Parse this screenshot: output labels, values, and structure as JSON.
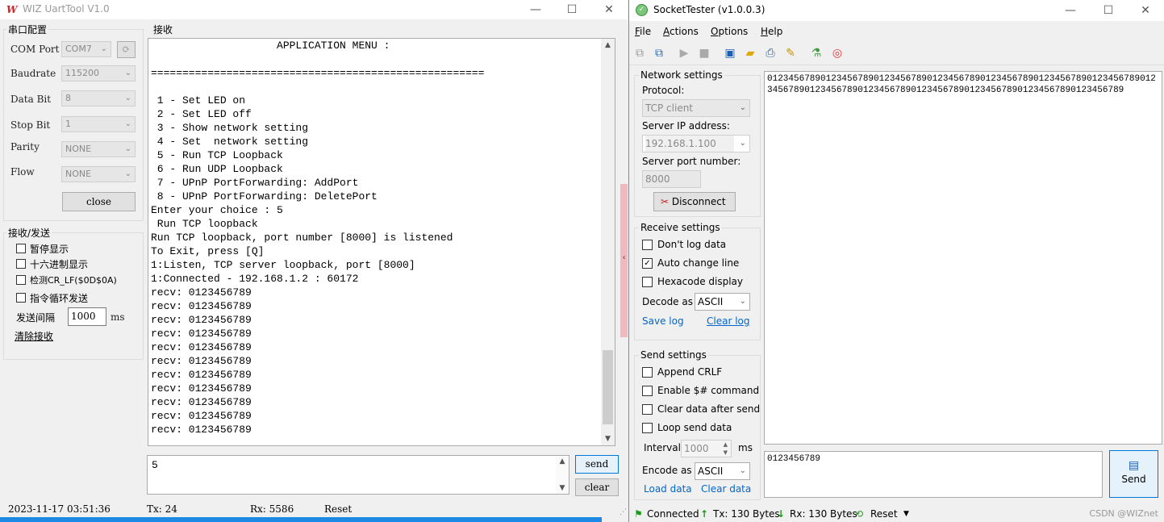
{
  "wiz": {
    "title": "WIZ UartTool V1.0",
    "logo": "W",
    "controls": {
      "minimize": "—",
      "maximize": "☐",
      "close": "✕"
    },
    "serial_config": {
      "title": "串口配置",
      "com_label": "COM Port",
      "com_value": "COM7",
      "baud_label": "Baudrate",
      "baud_value": "115200",
      "databit_label": "Data Bit",
      "databit_value": "8",
      "stopbit_label": "Stop Bit",
      "stopbit_value": "1",
      "parity_label": "Parity",
      "parity_value": "NONE",
      "flow_label": "Flow",
      "flow_value": "NONE",
      "close_button": "close"
    },
    "rxtx": {
      "title": "接收/发送",
      "pause_display": "暂停显示",
      "hex_display": "十六进制显示",
      "detect_crlf": "检测CR_LF($0D$0A)",
      "loop_send": "指令循环发送",
      "interval_label": "发送间隔",
      "interval_value": "1000",
      "interval_unit": "ms",
      "clear_receive": "清除接收"
    },
    "receive_title": "接收",
    "terminal_lines": [
      "                    APPLICATION MENU :",
      "",
      "=====================================================",
      "",
      " 1 - Set LED on",
      " 2 - Set LED off",
      " 3 - Show network setting",
      " 4 - Set  network setting",
      " 5 - Run TCP Loopback",
      " 6 - Run UDP Loopback",
      " 7 - UPnP PortForwarding: AddPort",
      " 8 - UPnP PortForwarding: DeletePort",
      "Enter your choice : 5",
      " Run TCP loopback",
      "Run TCP loopback, port number [8000] is listened",
      "To Exit, press [Q]",
      "1:Listen, TCP server loopback, port [8000]",
      "1:Connected - 192.168.1.2 : 60172",
      "recv: 0123456789",
      "recv: 0123456789",
      "recv: 0123456789",
      "recv: 0123456789",
      "recv: 0123456789",
      "recv: 0123456789",
      "recv: 0123456789",
      "recv: 0123456789",
      "recv: 0123456789",
      "recv: 0123456789",
      "recv: 0123456789"
    ],
    "send_text": "5",
    "send_button": "send",
    "clear_button": "clear",
    "status": {
      "datetime": "2023-11-17 03:51:36",
      "tx": "Tx: 24",
      "rx": "Rx: 5586",
      "reset": "Reset"
    }
  },
  "sock": {
    "title": "SocketTester (v1.0.0.3)",
    "controls": {
      "minimize": "—",
      "maximize": "☐",
      "close": "✕"
    },
    "menu": [
      {
        "key": "F",
        "rest": "ile"
      },
      {
        "key": "A",
        "rest": "ctions"
      },
      {
        "key": "O",
        "rest": "ptions"
      },
      {
        "key": "H",
        "rest": "elp"
      }
    ],
    "network": {
      "title": "Network settings",
      "protocol_label": "Protocol:",
      "protocol_value": "TCP client",
      "ip_label": "Server IP address:",
      "ip_value": "192.168.1.100",
      "port_label": "Server port number:",
      "port_value": "8000",
      "disconnect_button": "Disconnect"
    },
    "receive": {
      "title": "Receive settings",
      "dont_log": "Don't log data",
      "auto_change_line": "Auto change line",
      "hexcode": "Hexacode display",
      "decode_label": "Decode as",
      "decode_value": "ASCII",
      "save_log": "Save log",
      "clear_log": "Clear log"
    },
    "send": {
      "title": "Send settings",
      "append_crlf": "Append CRLF",
      "enable_cmd": "Enable $# command",
      "clear_after": "Clear data after send",
      "loop_send": "Loop send data",
      "interval_label": "Interval",
      "interval_value": "1000",
      "interval_unit": "ms",
      "encode_label": "Encode as",
      "encode_value": "ASCII",
      "load_data": "Load data",
      "clear_data": "Clear data"
    },
    "receive_text": "01234567890123456789012345678901234567890123456789012345678901234567890123456789012345678901234567890123456789012345678901234567890123456789",
    "send_text": "0123456789",
    "send_button": "Send",
    "status": {
      "connected": "Connected",
      "tx": "Tx: 130 Bytes",
      "rx": "Rx: 130 Bytes",
      "reset": "Reset"
    },
    "watermark": "CSDN @WIZnet"
  }
}
